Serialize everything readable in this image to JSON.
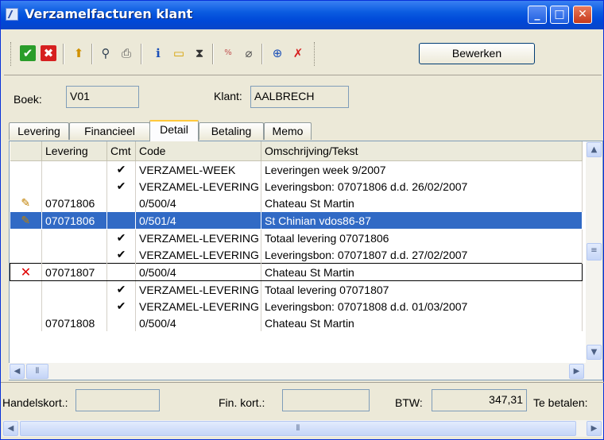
{
  "window": {
    "title": "Verzamelfacturen klant"
  },
  "toolbar": {
    "icons": [
      "check-icon",
      "cancel-icon",
      "export-icon",
      "search-icon",
      "print-icon",
      "info-icon",
      "folder-icon",
      "hourglass-icon",
      "calculator-icon",
      "attach-icon",
      "zoom-in-icon",
      "delete-icon"
    ],
    "edit_label": "Bewerken"
  },
  "header": {
    "boek_label": "Boek:",
    "boek_value": "V01",
    "klant_label": "Klant:",
    "klant_value": "AALBRECH"
  },
  "tabs": [
    "Levering",
    "Financieel",
    "Detail",
    "Betaling",
    "Memo"
  ],
  "active_tab": "Detail",
  "grid": {
    "columns": [
      "Levering",
      "Cmt",
      "Code",
      "Omschrijving/Tekst"
    ],
    "rows": [
      {
        "marker": "",
        "levering": "",
        "cmt": "✔",
        "code": "VERZAMEL-WEEK",
        "omschrijving": "Leveringen week 9/2007"
      },
      {
        "marker": "",
        "levering": "",
        "cmt": "✔",
        "code": "VERZAMEL-LEVERING",
        "omschrijving": "Leveringsbon: 07071806 d.d. 26/02/2007"
      },
      {
        "marker": "pencil",
        "levering": "07071806",
        "cmt": "",
        "code": "0/500/4",
        "omschrijving": "Chateau St Martin"
      },
      {
        "marker": "pencil",
        "levering": "07071806",
        "cmt": "",
        "code": "0/501/4",
        "omschrijving": "St Chinian vdos86-87"
      },
      {
        "marker": "",
        "levering": "",
        "cmt": "✔",
        "code": "VERZAMEL-LEVERING",
        "omschrijving": "Totaal levering 07071806"
      },
      {
        "marker": "",
        "levering": "",
        "cmt": "✔",
        "code": "VERZAMEL-LEVERING",
        "omschrijving": "Leveringsbon: 07071807 d.d. 27/02/2007"
      },
      {
        "marker": "x",
        "levering": "07071807",
        "cmt": "",
        "code": "0/500/4",
        "omschrijving": "Chateau St Martin"
      },
      {
        "marker": "",
        "levering": "",
        "cmt": "✔",
        "code": "VERZAMEL-LEVERING",
        "omschrijving": "Totaal levering 07071807"
      },
      {
        "marker": "",
        "levering": "",
        "cmt": "✔",
        "code": "VERZAMEL-LEVERING",
        "omschrijving": "Leveringsbon: 07071808 d.d. 01/03/2007"
      },
      {
        "marker": "",
        "levering": "07071808",
        "cmt": "",
        "code": "0/500/4",
        "omschrijving": "Chateau St Martin"
      }
    ]
  },
  "footer": {
    "handelskort_label": "Handelskort.:",
    "handelskort_value": "",
    "finkort_label": "Fin. kort.:",
    "finkort_value": "",
    "btw_label": "BTW:",
    "btw_value": "347,31",
    "tebetalen_label": "Te betalen:"
  },
  "colors": {
    "title_bar": "#0a5be0",
    "selection": "#316ac5",
    "delete_mark": "#e00000",
    "pencil_mark": "#c08000"
  }
}
